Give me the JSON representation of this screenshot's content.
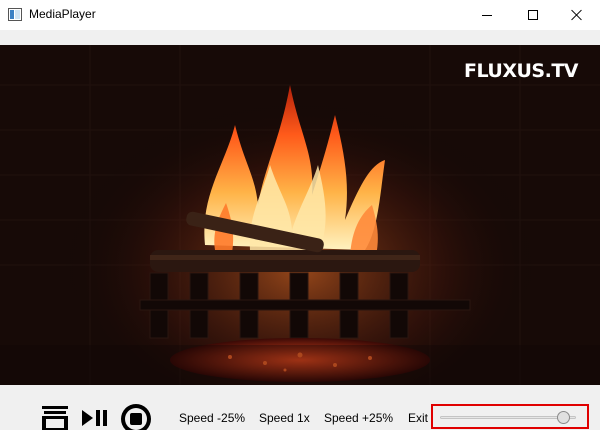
{
  "window": {
    "title": "MediaPlayer",
    "icon": "app-window-icon",
    "buttons": [
      "minimize-icon",
      "maximize-icon",
      "close-icon"
    ]
  },
  "video": {
    "logo_text": "FLUXUS.TV"
  },
  "controls": {
    "icons": [
      "playlist-icon",
      "play-pause-icon",
      "stop-icon"
    ],
    "speed_down_label": "Speed -25%",
    "speed_normal_label": "Speed 1x",
    "speed_up_label": "Speed +25%",
    "exit_label": "Exit",
    "volume_level": 0.95,
    "highlight_color": "#e00000"
  }
}
